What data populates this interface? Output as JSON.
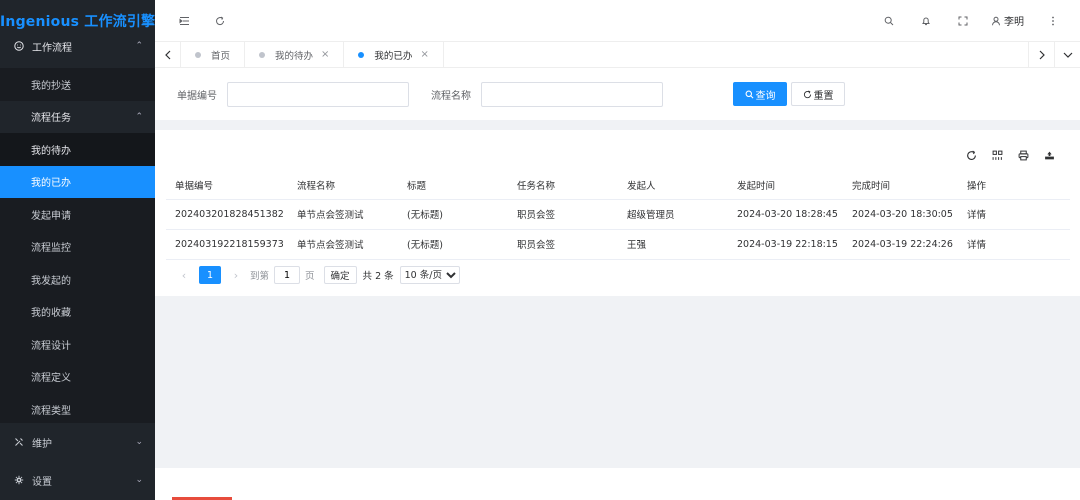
{
  "app": {
    "title": "Ingenious 工作流引擎"
  },
  "sidebar": {
    "group": {
      "label": "工作流程",
      "icon": "smile-icon"
    },
    "items": [
      {
        "label": "我的抄送"
      },
      {
        "label": "流程任务"
      },
      {
        "label": "我的待办"
      },
      {
        "label": "我的已办"
      },
      {
        "label": "发起申请"
      },
      {
        "label": "流程监控"
      },
      {
        "label": "我发起的"
      },
      {
        "label": "我的收藏"
      },
      {
        "label": "流程设计"
      },
      {
        "label": "流程定义"
      },
      {
        "label": "流程类型"
      }
    ],
    "bottom": [
      {
        "label": "维护",
        "icon": "tools-icon"
      },
      {
        "label": "设置",
        "icon": "gear-icon"
      }
    ]
  },
  "header": {
    "user": "李明"
  },
  "tabs": [
    {
      "label": "首页",
      "active": false,
      "closable": false
    },
    {
      "label": "我的待办",
      "active": false,
      "closable": true
    },
    {
      "label": "我的已办",
      "active": true,
      "closable": true
    }
  ],
  "search": {
    "fields": [
      {
        "label": "单据编号",
        "value": ""
      },
      {
        "label": "流程名称",
        "value": ""
      }
    ],
    "query_label": "查询",
    "reset_label": "重置"
  },
  "table": {
    "columns": [
      "单据编号",
      "流程名称",
      "标题",
      "任务名称",
      "发起人",
      "发起时间",
      "完成时间",
      "操作"
    ],
    "rows": [
      [
        "202403201828451382",
        "单节点会签测试",
        "(无标题)",
        "职员会签",
        "超级管理员",
        "2024-03-20 18:28:45",
        "2024-03-20 18:30:05",
        "详情"
      ],
      [
        "202403192218159373",
        "单节点会签测试",
        "(无标题)",
        "职员会签",
        "王强",
        "2024-03-19 22:18:15",
        "2024-03-19 22:24:26",
        "详情"
      ]
    ]
  },
  "pagination": {
    "current": "1",
    "goto_label": "到第",
    "goto_value": "1",
    "page_unit": "页",
    "confirm_label": "确定",
    "total_label": "共 2 条",
    "page_size": "10 条/页"
  },
  "colors": {
    "accent": "#1890ff",
    "sidebar_bg": "#20252b"
  }
}
